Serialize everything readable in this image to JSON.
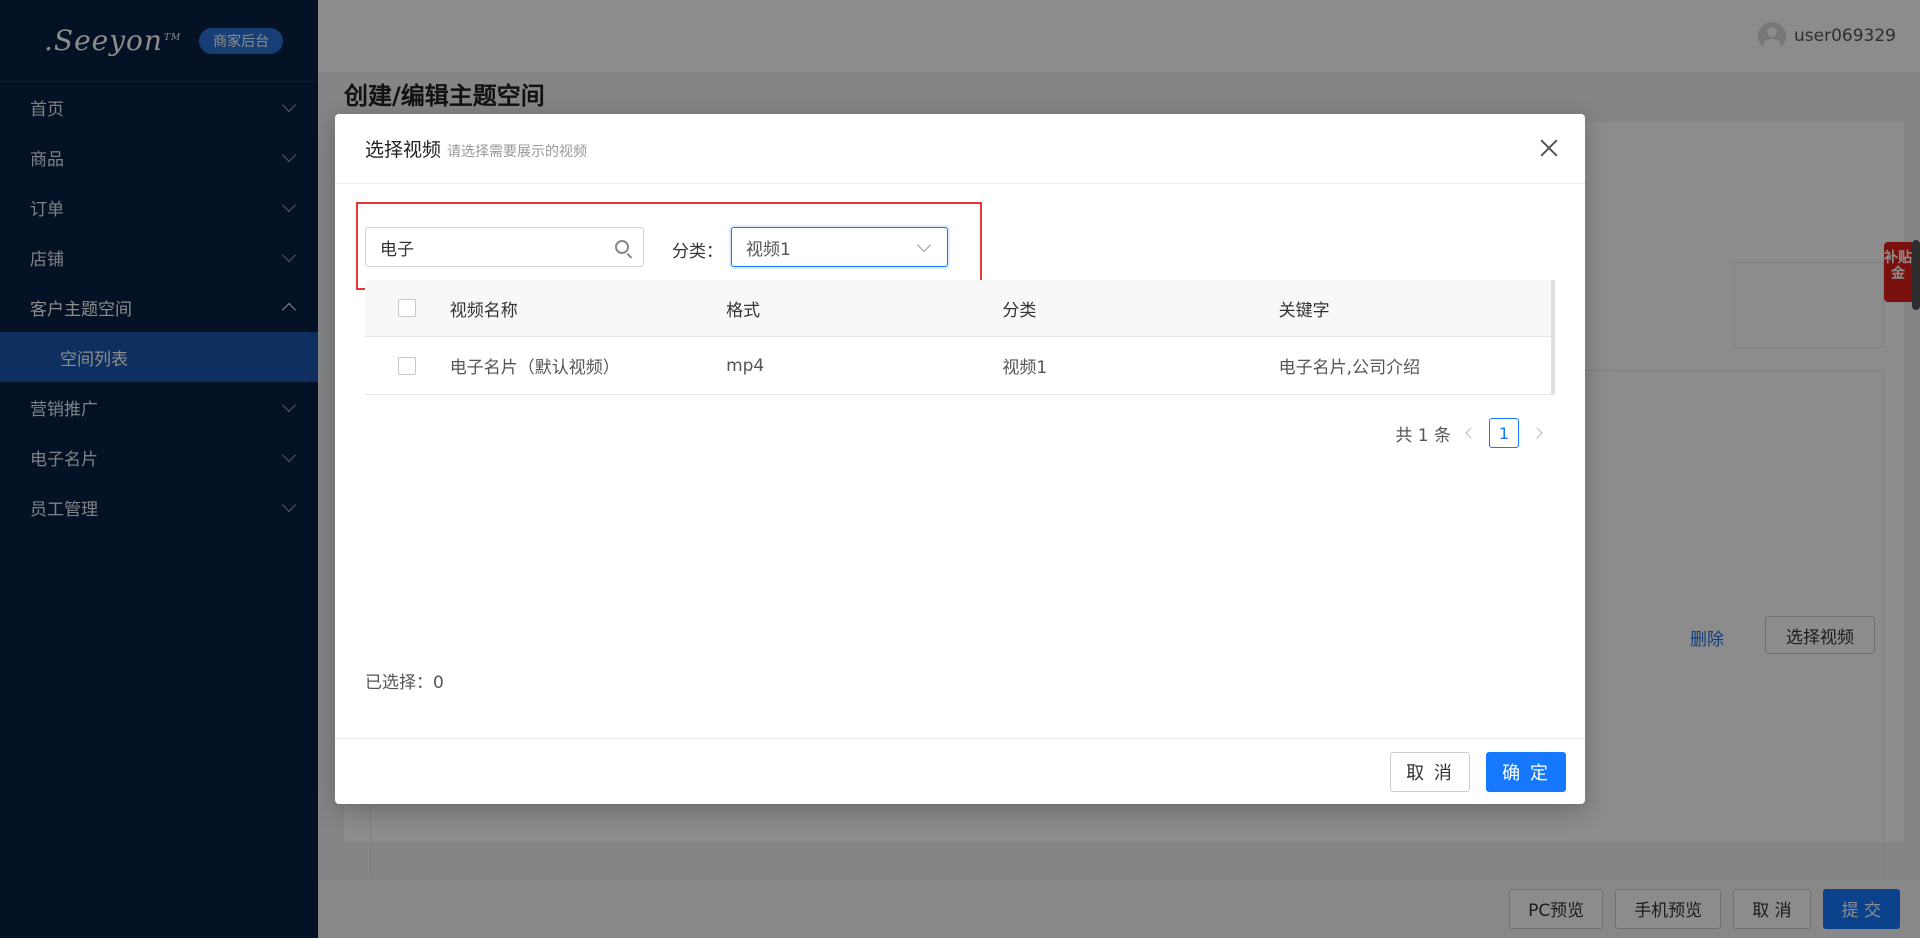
{
  "sidebar": {
    "logo_text": ".Seeyon",
    "logo_tm": "TM",
    "badge": "商家后台",
    "items": [
      {
        "label": "首页"
      },
      {
        "label": "商品"
      },
      {
        "label": "订单"
      },
      {
        "label": "店铺"
      },
      {
        "label": "客户主题空间"
      },
      {
        "label": "空间列表"
      },
      {
        "label": "营销推广"
      },
      {
        "label": "电子名片"
      },
      {
        "label": "员工管理"
      }
    ]
  },
  "header": {
    "username": "user069329",
    "page_title": "创建/编辑主题空间"
  },
  "background": {
    "delete_label": "删除",
    "select_video_label": "选择视频",
    "side_tag": "补贴金",
    "bottom_buttons": {
      "pc_preview": "PC预览",
      "mobile_preview": "手机预览",
      "cancel": "取 消",
      "submit": "提 交"
    }
  },
  "modal": {
    "title": "选择视频",
    "subtitle": "请选择需要展示的视频",
    "search": {
      "value": "电子"
    },
    "filter_label": "分类：",
    "category_select": {
      "value": "视频1"
    },
    "table": {
      "columns": [
        "视频名称",
        "格式",
        "分类",
        "关键字"
      ],
      "rows": [
        [
          "电子名片（默认视频）",
          "mp4",
          "视频1",
          "电子名片,公司介绍"
        ]
      ]
    },
    "pagination": {
      "total": "共 1 条",
      "current": "1"
    },
    "selected": "已选择：0",
    "cancel": "取 消",
    "confirm": "确 定"
  },
  "colors": {
    "sidebar_bg": "#0a1f44",
    "sidebar_active": "#1a56ad",
    "primary": "#1677ff",
    "highlight_box": "#e53935"
  }
}
